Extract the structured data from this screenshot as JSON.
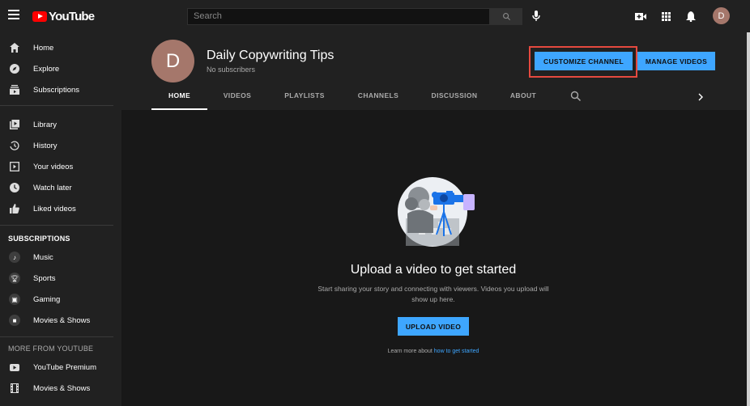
{
  "app": {
    "logo_text": "YouTube"
  },
  "topbar": {
    "search_placeholder": "Search",
    "avatar_letter": "D",
    "icons": [
      "menu-icon",
      "search-icon",
      "mic-icon",
      "create-video-icon",
      "apps-icon",
      "notifications-icon"
    ]
  },
  "sidebar": {
    "main": [
      {
        "label": "Home",
        "icon": "home-icon"
      },
      {
        "label": "Explore",
        "icon": "compass-icon"
      },
      {
        "label": "Subscriptions",
        "icon": "subscriptions-icon"
      }
    ],
    "library": [
      {
        "label": "Library",
        "icon": "library-icon"
      },
      {
        "label": "History",
        "icon": "history-icon"
      },
      {
        "label": "Your videos",
        "icon": "your-videos-icon"
      },
      {
        "label": "Watch later",
        "icon": "clock-icon"
      },
      {
        "label": "Liked videos",
        "icon": "thumbs-up-icon"
      }
    ],
    "subscriptions_heading": "SUBSCRIPTIONS",
    "subscriptions": [
      {
        "label": "Music",
        "icon": "music-icon"
      },
      {
        "label": "Sports",
        "icon": "trophy-icon"
      },
      {
        "label": "Gaming",
        "icon": "gamepad-icon"
      },
      {
        "label": "Movies & Shows",
        "icon": "film-icon"
      }
    ],
    "more_heading": "MORE FROM YOUTUBE",
    "more": [
      {
        "label": "YouTube Premium",
        "icon": "youtube-premium-icon"
      },
      {
        "label": "Movies & Shows",
        "icon": "film-strip-icon"
      }
    ]
  },
  "channel": {
    "avatar_letter": "D",
    "title": "Daily Copywriting Tips",
    "subscribers": "No subscribers",
    "customize_label": "CUSTOMIZE CHANNEL",
    "manage_label": "MANAGE VIDEOS",
    "tabs": [
      "HOME",
      "VIDEOS",
      "PLAYLISTS",
      "CHANNELS",
      "DISCUSSION",
      "ABOUT"
    ],
    "active_tab": "HOME"
  },
  "empty_state": {
    "title": "Upload a video to get started",
    "description": "Start sharing your story and connecting with viewers. Videos you upload will show up here.",
    "upload_label": "UPLOAD VIDEO",
    "learn_prefix": "Learn more about",
    "learn_link": "how to get started"
  },
  "colors": {
    "accent": "#3ea6ff",
    "brand_red": "#ff0000",
    "highlight_box": "#e5493f",
    "avatar": "#a5776b"
  }
}
